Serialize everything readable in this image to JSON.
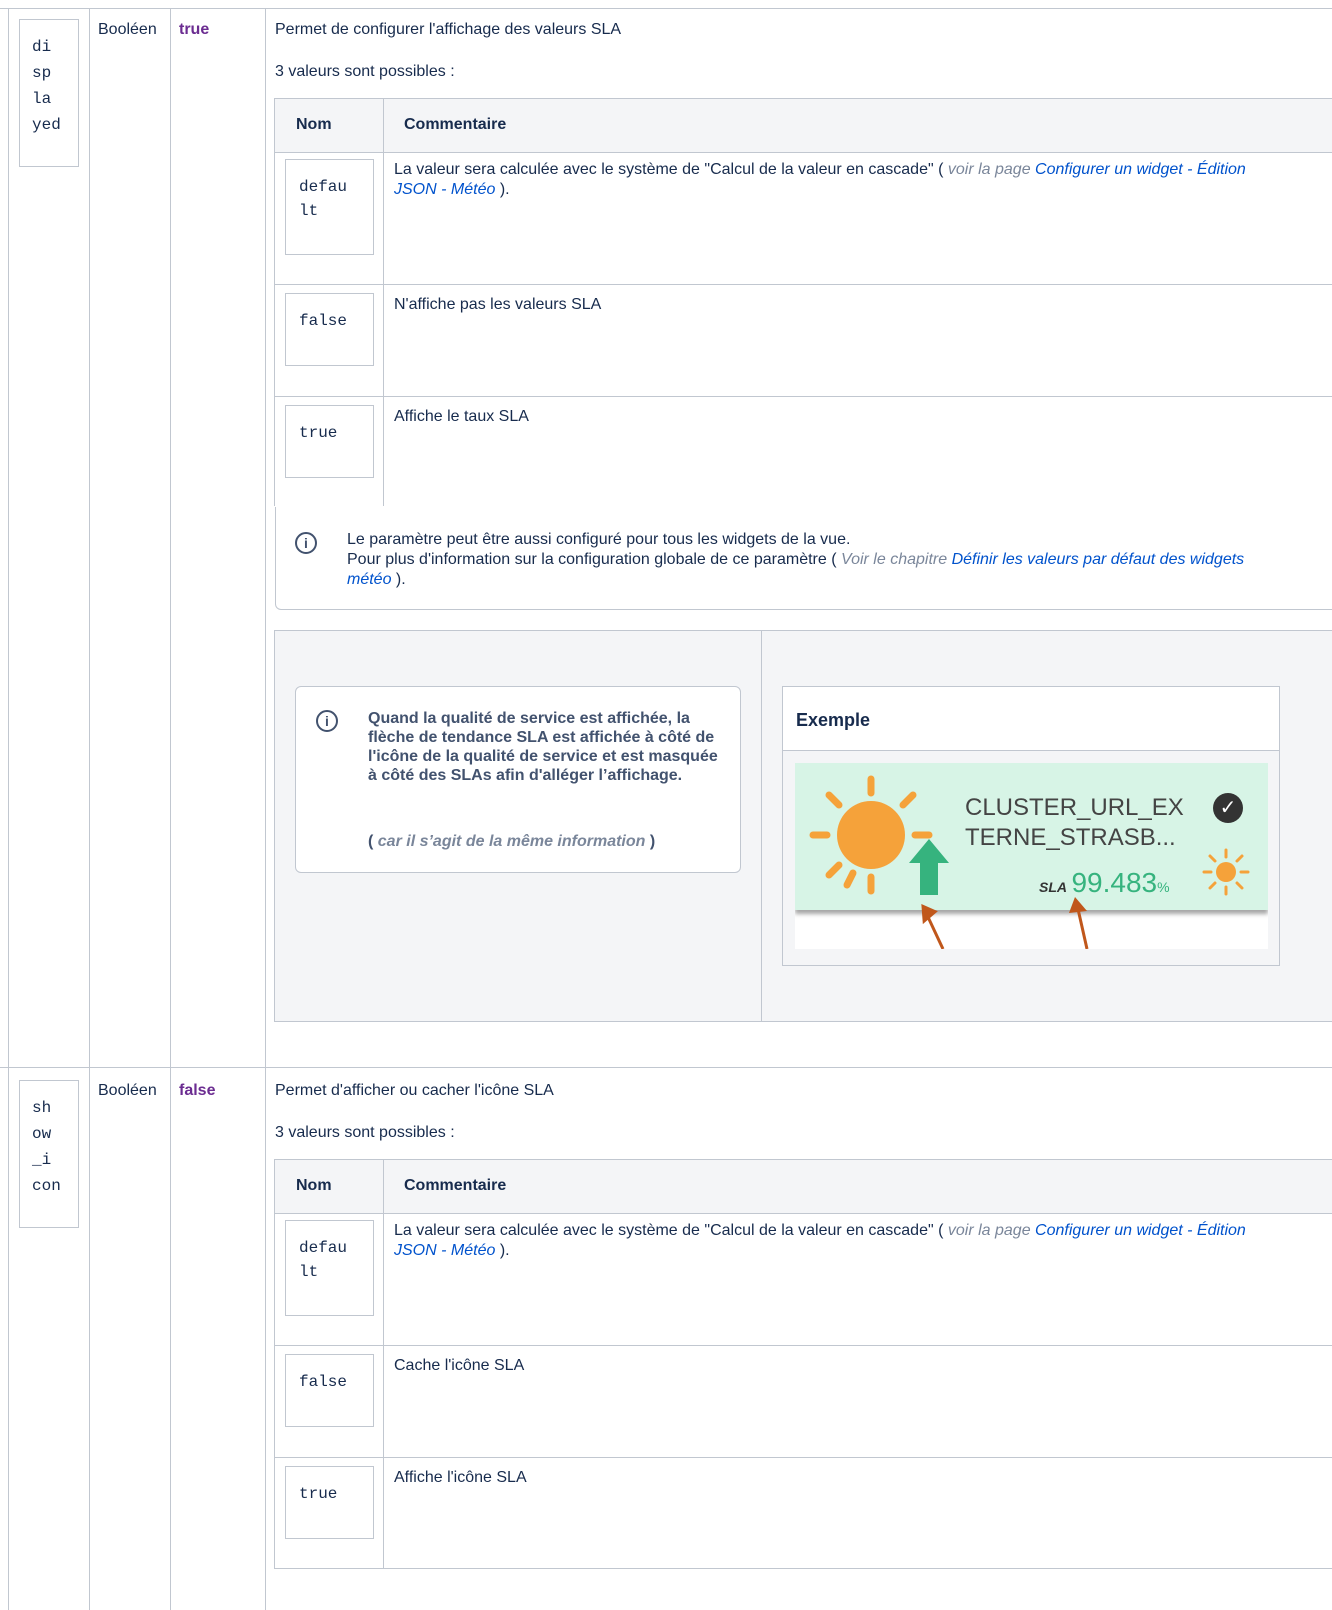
{
  "rows": [
    {
      "param": [
        "di",
        "sp",
        "la",
        "yed"
      ],
      "type": "Booléen",
      "default": "true",
      "description": "Permet de configurer l'affichage des valeurs SLA",
      "count_text": "3 valeurs sont possibles :",
      "table_headers": {
        "name": "Nom",
        "comment": "Commentaire"
      },
      "options": [
        {
          "name": [
            "defau",
            "lt"
          ],
          "comment": "La valeur sera calculée avec le système de \"Calcul de la valeur en cascade\" (",
          "note": "voir la page",
          "link": "Configurer un widget - Édition JSON - Météo",
          "end": ")."
        },
        {
          "name": [
            "false"
          ],
          "comment": "N'affiche pas les valeurs SLA"
        },
        {
          "name": [
            "true"
          ],
          "comment": "Affiche le taux SLA"
        }
      ],
      "info": {
        "line1": "Le paramètre peut être aussi configuré pour tous les widgets de la vue.",
        "line2": "Pour plus d'information sur la configuration globale de ce paramètre (",
        "note": "Voir le chapitre",
        "link": "Définir les valeurs par défaut des widgets météo",
        "end": ")."
      },
      "tip": {
        "bold_text": "Quand la qualité de service est affichée, la flèche de tendance SLA est affichée à côté de l'icône de la qualité de service et est masquée à côté des SLAs afin d'alléger l’affichage.",
        "paren_open": "(",
        "paren_text": "car il s’agit de la même information",
        "paren_close": ")"
      },
      "example": {
        "title": "Exemple",
        "widget_name_1": "CLUSTER_URL_EX",
        "widget_name_2": "TERNE_STRASB...",
        "sla_label": "SLA",
        "sla_value": "99.483",
        "sla_unit": "%"
      }
    },
    {
      "param": [
        "sh",
        "ow",
        "_i",
        "con"
      ],
      "type": "Booléen",
      "default": "false",
      "description": "Permet d'afficher ou cacher l'icône SLA",
      "count_text": "3 valeurs sont possibles :",
      "table_headers": {
        "name": "Nom",
        "comment": "Commentaire"
      },
      "options": [
        {
          "name": [
            "defau",
            "lt"
          ],
          "comment": "La valeur sera calculée avec le système de \"Calcul de la valeur en cascade\" (",
          "note": "voir la page",
          "link": "Configurer un widget - Édition JSON - Météo",
          "end": ")."
        },
        {
          "name": [
            "false"
          ],
          "comment": "Cache l'icône SLA"
        },
        {
          "name": [
            "true"
          ],
          "comment": "Affiche l'icône SLA"
        }
      ]
    }
  ],
  "colors": {
    "border": "#c1c7d0",
    "value_purple": "#6b2c91",
    "link": "#0052cc",
    "sla_green": "#36b37e",
    "panel_bg": "#f4f5f7"
  }
}
